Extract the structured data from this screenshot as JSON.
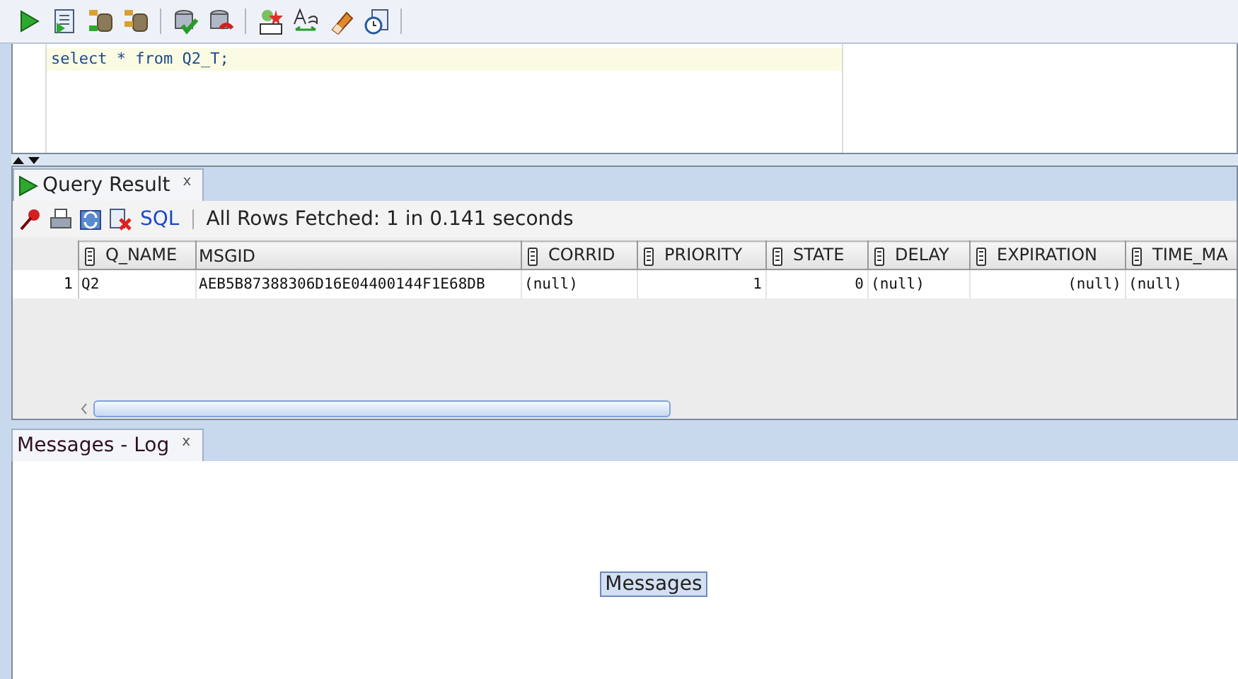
{
  "editor": {
    "lines": [
      "select * from Q2_T;"
    ]
  },
  "result_tab": {
    "label": "Query Result",
    "close": "x",
    "selected": true
  },
  "result_toolbar": {
    "sql_link": "SQL",
    "status": "All Rows Fetched: 1 in 0.141 seconds"
  },
  "grid": {
    "columns": [
      {
        "label": "Q_NAME",
        "sortable": true,
        "kind": "text"
      },
      {
        "label": "MSGID",
        "sortable": false,
        "kind": "text"
      },
      {
        "label": "CORRID",
        "sortable": true,
        "kind": "text"
      },
      {
        "label": "PRIORITY",
        "sortable": true,
        "kind": "number"
      },
      {
        "label": "STATE",
        "sortable": true,
        "kind": "number"
      },
      {
        "label": "DELAY",
        "sortable": true,
        "kind": "text"
      },
      {
        "label": "EXPIRATION",
        "sortable": true,
        "kind": "number"
      },
      {
        "label": "TIME_MA",
        "sortable": true,
        "kind": "text"
      }
    ],
    "rows": [
      {
        "number": "1",
        "cells": [
          "Q2",
          "AEB5B87388306D16E04400144F1E68DB",
          "(null)",
          "1",
          "0",
          "(null)",
          "(null)",
          "(null)"
        ]
      }
    ]
  },
  "messages_tab": {
    "label": "Messages - Log",
    "close": "x",
    "selected": true
  },
  "messages_button": "Messages"
}
